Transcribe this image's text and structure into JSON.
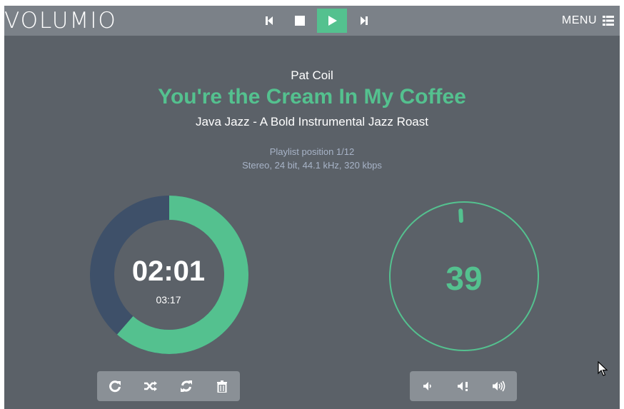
{
  "header": {
    "logo": "VOLUMIO",
    "menu_label": "MENU",
    "transport": {
      "prev_icon": "skip-previous-icon",
      "stop_icon": "stop-icon",
      "play_icon": "play-icon",
      "next_icon": "skip-next-icon"
    },
    "menu_icon": "list-icon"
  },
  "track": {
    "artist": "Pat Coil",
    "title": "You're the Cream In My Coffee",
    "album": "Java Jazz - A Bold Instrumental Jazz Roast",
    "playlist_position": "Playlist position 1/12",
    "format": "Stereo, 24 bit, 44.1 kHz, 320 kbps"
  },
  "time": {
    "elapsed": "02:01",
    "total": "03:17",
    "progress_fraction": 0.614
  },
  "volume": {
    "value": "39",
    "level_fraction": 0.39
  },
  "playback_controls": [
    "repeat-icon",
    "shuffle-icon",
    "refresh-icon",
    "trash-icon"
  ],
  "volume_controls": [
    "volume-down-icon",
    "mute-icon",
    "volume-up-icon"
  ],
  "colors": {
    "accent": "#54c18f",
    "background": "#5b6168",
    "header": "#7b8188",
    "knob_track": "#3e5069",
    "panel": "#8a9096"
  }
}
